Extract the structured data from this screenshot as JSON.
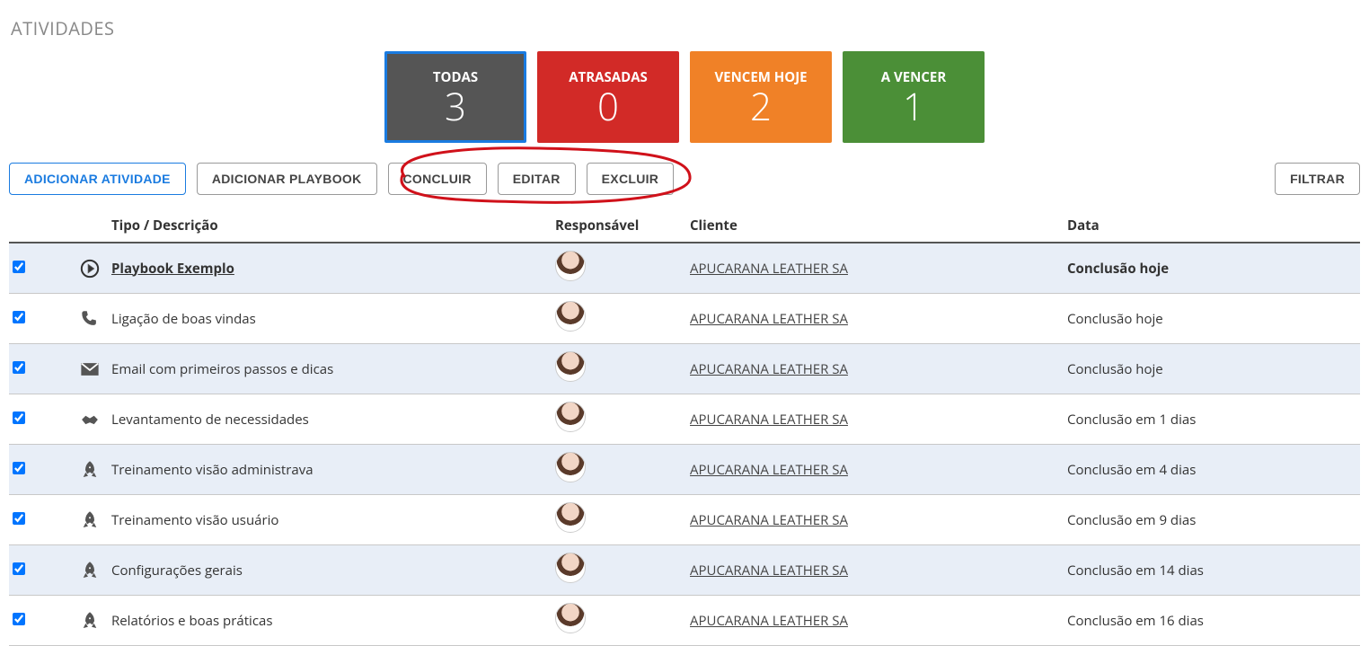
{
  "title": "ATIVIDADES",
  "cards": {
    "all": {
      "label": "TODAS",
      "value": "3"
    },
    "late": {
      "label": "ATRASADAS",
      "value": "0"
    },
    "today": {
      "label": "VENCEM HOJE",
      "value": "2"
    },
    "future": {
      "label": "A VENCER",
      "value": "1"
    }
  },
  "toolbar": {
    "add_activity": "ADICIONAR ATIVIDADE",
    "add_playbook": "ADICIONAR PLAYBOOK",
    "conclude": "CONCLUIR",
    "edit": "EDITAR",
    "delete": "EXCLUIR",
    "filter": "FILTRAR"
  },
  "table": {
    "headers": {
      "type": "Tipo / Descrição",
      "resp": "Responsável",
      "client": "Cliente",
      "date": "Data"
    },
    "rows": [
      {
        "indent": 0,
        "icon": "play",
        "desc": "Playbook Exemplo",
        "link": true,
        "client": "APUCARANA LEATHER SA",
        "date": "Conclusão hoje",
        "bold": true
      },
      {
        "indent": 1,
        "icon": "phone",
        "desc": "Ligação de boas vindas",
        "link": false,
        "client": "APUCARANA LEATHER SA",
        "date": "Conclusão hoje",
        "bold": false
      },
      {
        "indent": 1,
        "icon": "mail",
        "desc": "Email com primeiros passos e dicas",
        "link": false,
        "client": "APUCARANA LEATHER SA",
        "date": "Conclusão hoje",
        "bold": false
      },
      {
        "indent": 1,
        "icon": "handshake",
        "desc": "Levantamento de necessidades",
        "link": false,
        "client": "APUCARANA LEATHER SA",
        "date": "Conclusão em 1 dias",
        "bold": false
      },
      {
        "indent": 1,
        "icon": "rocket",
        "desc": "Treinamento visão administrava",
        "link": false,
        "client": "APUCARANA LEATHER SA",
        "date": "Conclusão em 4 dias",
        "bold": false
      },
      {
        "indent": 1,
        "icon": "rocket",
        "desc": "Treinamento visão usuário",
        "link": false,
        "client": "APUCARANA LEATHER SA",
        "date": "Conclusão em 9 dias",
        "bold": false
      },
      {
        "indent": 1,
        "icon": "rocket",
        "desc": "Configurações gerais",
        "link": false,
        "client": "APUCARANA LEATHER SA",
        "date": "Conclusão em 14 dias",
        "bold": false
      },
      {
        "indent": 1,
        "icon": "rocket",
        "desc": "Relatórios e boas práticas",
        "link": false,
        "client": "APUCARANA LEATHER SA",
        "date": "Conclusão em 16 dias",
        "bold": false
      }
    ]
  }
}
